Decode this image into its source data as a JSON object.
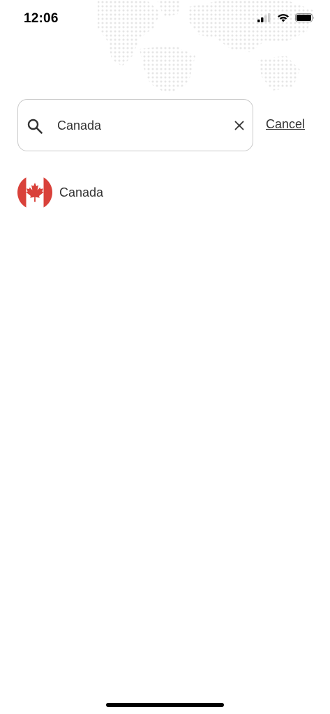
{
  "status_bar": {
    "time": "12:06",
    "icons": [
      "cellular-signal-icon",
      "wifi-icon",
      "battery-icon"
    ]
  },
  "search": {
    "value": "Canada",
    "placeholder": "",
    "cancel_label": "Cancel"
  },
  "results": [
    {
      "label": "Canada",
      "flag": "canada-flag-icon"
    }
  ],
  "colors": {
    "flag_red": "#d9413a",
    "border": "#c9c9c9",
    "text": "#333333"
  }
}
